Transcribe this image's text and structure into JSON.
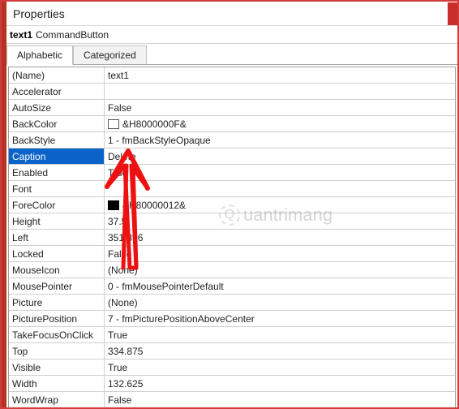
{
  "window": {
    "title": "Properties",
    "object_name": "text1",
    "object_type": "CommandButton"
  },
  "tabs": {
    "alphabetic": "Alphabetic",
    "categorized": "Categorized"
  },
  "props": {
    "name_label": "(Name)",
    "name_value": "text1",
    "accelerator_label": "Accelerator",
    "accelerator_value": "",
    "autosize_label": "AutoSize",
    "autosize_value": "False",
    "backcolor_label": "BackColor",
    "backcolor_value": "&H8000000F&",
    "backstyle_label": "BackStyle",
    "backstyle_value": "1 - fmBackStyleOpaque",
    "caption_label": "Caption",
    "caption_value": "Delete",
    "enabled_label": "Enabled",
    "enabled_value": "True",
    "font_label": "Font",
    "font_value": "",
    "forecolor_label": "ForeColor",
    "forecolor_value": "&H80000012&",
    "height_label": "Height",
    "height_value": "37.5",
    "left_label": "Left",
    "left_value": "351.896",
    "locked_label": "Locked",
    "locked_value": "False",
    "mouseicon_label": "MouseIcon",
    "mouseicon_value": "(None)",
    "mousepointer_label": "MousePointer",
    "mousepointer_value": "0 - fmMousePointerDefault",
    "picture_label": "Picture",
    "picture_value": "(None)",
    "pictureposition_label": "PicturePosition",
    "pictureposition_value": "7 - fmPicturePositionAboveCenter",
    "takefocus_label": "TakeFocusOnClick",
    "takefocus_value": "True",
    "top_label": "Top",
    "top_value": "334.875",
    "visible_label": "Visible",
    "visible_value": "True",
    "width_label": "Width",
    "width_value": "132.625",
    "wordwrap_label": "WordWrap",
    "wordwrap_value": "False"
  },
  "watermark": {
    "text": "uantrimang",
    "q": "Q"
  }
}
